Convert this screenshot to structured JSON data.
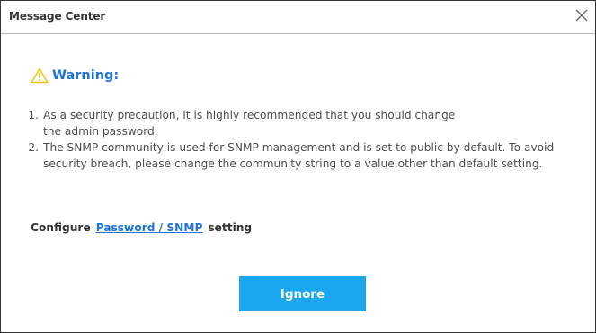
{
  "window": {
    "title": "Message Center",
    "close_icon": "close-icon"
  },
  "warning": {
    "icon": "warning-triangle-icon",
    "title": "Warning:",
    "items": [
      {
        "number": "1.",
        "text": "As a security precaution, it is highly recommended that you should change the admin password."
      },
      {
        "number": "2.",
        "text": "The SNMP community is used for SNMP management and is set to public by default. To avoid security breach, please change the community string to a value other than default setting."
      }
    ]
  },
  "configure": {
    "prefix": "Configure",
    "link_label": "Password / SNMP",
    "suffix": "setting"
  },
  "actions": {
    "ignore_label": "Ignore"
  },
  "colors": {
    "accent": "#1e73d9",
    "button": "#19a7ef",
    "warning_icon": "#f5c518"
  }
}
